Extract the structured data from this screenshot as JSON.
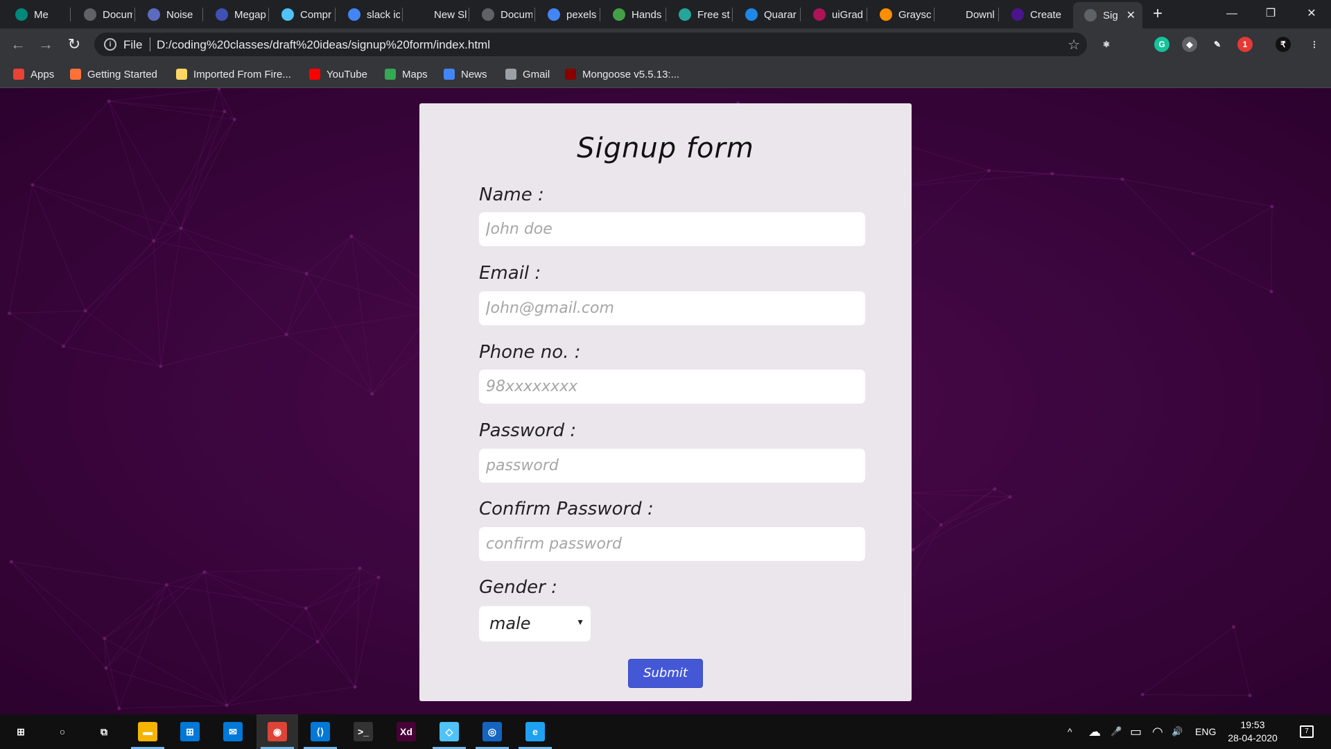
{
  "browser": {
    "tabs": [
      {
        "title": "Me",
        "icon": "google-meet-icon",
        "color": "#00897b"
      },
      {
        "title": "Docum",
        "icon": "globe-icon",
        "color": "#5f6368"
      },
      {
        "title": "Noise",
        "icon": "noise-icon",
        "color": "#5c6bc0"
      },
      {
        "title": "Megap",
        "icon": "megaphone-icon",
        "color": "#3f51b5"
      },
      {
        "title": "Compr",
        "icon": "compress-icon",
        "color": "#4fc3f7"
      },
      {
        "title": "slack ic",
        "icon": "google-icon",
        "color": "#4285f4"
      },
      {
        "title": "New Sl",
        "icon": "dot-icon",
        "color": "#202124"
      },
      {
        "title": "Docum",
        "icon": "globe-icon",
        "color": "#5f6368"
      },
      {
        "title": "pexels",
        "icon": "google-icon",
        "color": "#4285f4"
      },
      {
        "title": "Hands",
        "icon": "px-icon",
        "color": "#43a047"
      },
      {
        "title": "Free st",
        "icon": "free-icon",
        "color": "#26a69a"
      },
      {
        "title": "Quarar",
        "icon": "quarantine-icon",
        "color": "#1e88e5"
      },
      {
        "title": "uiGrad",
        "icon": "uigradients-icon",
        "color": "#ad1457"
      },
      {
        "title": "Graysc",
        "icon": "grayscale-icon",
        "color": "#ff8f00"
      },
      {
        "title": "Downl",
        "icon": "download-icon",
        "color": "#202124"
      },
      {
        "title": "Create",
        "icon": "create-icon",
        "color": "#4a148c"
      },
      {
        "title": "Sig",
        "icon": "globe-icon",
        "color": "#5f6368"
      }
    ],
    "active_tab_close": "✕",
    "new_tab": "+",
    "window_controls": {
      "minimize": "—",
      "restore": "❐",
      "close": "✕"
    },
    "nav": {
      "back": "←",
      "forward": "→",
      "reload": "↻"
    },
    "omnibox": {
      "info": "i",
      "scheme": "File",
      "url": "D:/coding%20classes/draft%20ideas/signup%20form/index.html",
      "star": "☆"
    },
    "extensions": [
      {
        "name": "react-devtools-icon",
        "label": "⚛",
        "color": "#35363a"
      },
      {
        "name": "grammarly-icon",
        "label": "G",
        "color": "#15c39a"
      },
      {
        "name": "layers-icon",
        "label": "◆",
        "color": "#5f6368"
      },
      {
        "name": "pen-icon",
        "label": "✎",
        "color": "#35363a"
      },
      {
        "name": "notification-icon",
        "label": "1",
        "color": "#e53935"
      },
      {
        "name": "profile-icon",
        "label": "₹",
        "color": "#111111"
      },
      {
        "name": "menu-icon",
        "label": "⋮",
        "color": "#35363a"
      }
    ],
    "bookmarks": [
      {
        "label": "Apps",
        "icon": "apps-grid-icon",
        "color": "#ea4335"
      },
      {
        "label": "Getting Started",
        "icon": "firefox-icon",
        "color": "#ff7139"
      },
      {
        "label": "Imported From Fire...",
        "icon": "folder-icon",
        "color": "#fdd663"
      },
      {
        "label": "YouTube",
        "icon": "youtube-icon",
        "color": "#ff0000"
      },
      {
        "label": "Maps",
        "icon": "maps-pin-icon",
        "color": "#34a853"
      },
      {
        "label": "News",
        "icon": "google-news-icon",
        "color": "#4285f4"
      },
      {
        "label": "Gmail",
        "icon": "globe-icon",
        "color": "#9aa0a6"
      },
      {
        "label": "Mongoose v5.5.13:...",
        "icon": "mongoose-icon",
        "color": "#880000"
      }
    ]
  },
  "form": {
    "title": "Signup form",
    "fields": [
      {
        "label": "Name :",
        "placeholder": "John doe"
      },
      {
        "label": "Email :",
        "placeholder": "John@gmail.com"
      },
      {
        "label": "Phone no. :",
        "placeholder": "98xxxxxxxx"
      },
      {
        "label": "Password :",
        "placeholder": "password"
      },
      {
        "label": "Confirm Password :",
        "placeholder": "confirm password"
      }
    ],
    "gender_label": "Gender :",
    "gender_value": "male",
    "gender_arrow": "▼",
    "submit_label": "Submit"
  },
  "taskbar": {
    "apps": [
      {
        "name": "windows-start-icon",
        "label": "⊞",
        "color": "#101010"
      },
      {
        "name": "cortana-search-icon",
        "label": "○",
        "color": "#101010"
      },
      {
        "name": "task-view-icon",
        "label": "⧉",
        "color": "#101010"
      },
      {
        "name": "file-explorer-icon",
        "label": "▬",
        "color": "#f4b400"
      },
      {
        "name": "microsoft-store-icon",
        "label": "⊞",
        "color": "#0078d7"
      },
      {
        "name": "mail-icon",
        "label": "✉",
        "color": "#0078d7"
      },
      {
        "name": "chrome-icon",
        "label": "◉",
        "color": "#db4437"
      },
      {
        "name": "vscode-icon",
        "label": "⟨⟩",
        "color": "#0078d7"
      },
      {
        "name": "terminal-icon",
        "label": ">_",
        "color": "#333333"
      },
      {
        "name": "adobe-xd-icon",
        "label": "Xd",
        "color": "#470137"
      },
      {
        "name": "app-icon",
        "label": "◇",
        "color": "#4fc3f7"
      },
      {
        "name": "app2-icon",
        "label": "◎",
        "color": "#1565c0"
      },
      {
        "name": "internet-explorer-icon",
        "label": "e",
        "color": "#1ea1f1"
      }
    ],
    "tray": {
      "chevron": "^",
      "cloud": "☁",
      "mic": "🎤",
      "battery": "▭",
      "wifi": "◠",
      "volume": "🔊",
      "language": "ENG",
      "time": "19:53",
      "date": "28-04-2020",
      "notifications": "7"
    }
  },
  "colors": {
    "page_bg": "#3a053c",
    "card_bg": "#ebe5ec",
    "submit_bg": "#4458d6"
  }
}
